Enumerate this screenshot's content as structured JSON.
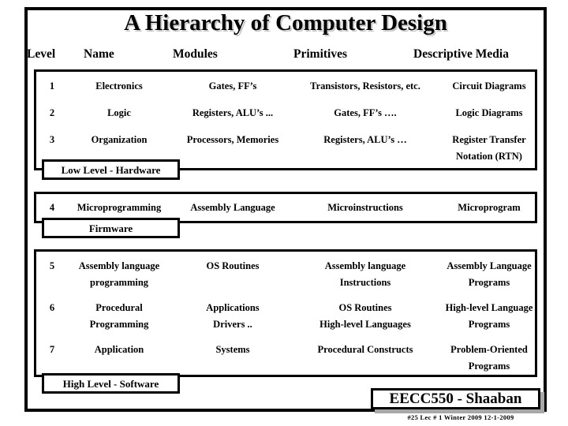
{
  "slide": {
    "title": "A Hierarchy of Computer Design",
    "columns": {
      "level": "Level",
      "name": "Name",
      "modules": "Modules",
      "primitives": "Primitives",
      "descriptive_media": "Descriptive  Media"
    },
    "groups": [
      {
        "id": "hardware",
        "tab_label": "Low Level - Hardware",
        "rows": [
          {
            "level": "1",
            "name": "Electronics",
            "modules": "Gates, FF’s",
            "primitives": "Transistors, Resistors, etc.",
            "descriptive_media": "Circuit Diagrams"
          },
          {
            "level": "2",
            "name": "Logic",
            "modules": "Registers, ALU’s ...",
            "primitives": "Gates, FF’s ….",
            "descriptive_media": "Logic Diagrams"
          },
          {
            "level": "3",
            "name": "Organization",
            "modules": "Processors, Memories",
            "primitives": "Registers, ALU’s …",
            "descriptive_media": "Register Transfer\nNotation (RTN)"
          }
        ]
      },
      {
        "id": "firmware",
        "tab_label": "Firmware",
        "rows": [
          {
            "level": "4",
            "name": "Microprogramming",
            "modules": "Assembly Language",
            "primitives": "Microinstructions",
            "descriptive_media": "Microprogram"
          }
        ]
      },
      {
        "id": "software",
        "tab_label": "High Level - Software",
        "rows": [
          {
            "level": "5",
            "name": "Assembly language\nprogramming",
            "modules": "OS Routines",
            "primitives": "Assembly language\nInstructions",
            "descriptive_media": "Assembly Language\nPrograms"
          },
          {
            "level": "6",
            "name": "Procedural\nProgramming",
            "modules": "Applications\nDrivers ..",
            "primitives": "OS Routines\nHigh-level Languages",
            "descriptive_media": "High-level Language\nPrograms"
          },
          {
            "level": "7",
            "name": "Application",
            "modules": "Systems",
            "primitives": "Procedural Constructs",
            "descriptive_media": "Problem-Oriented\nPrograms"
          }
        ]
      }
    ],
    "footer": {
      "badge": "EECC550 - Shaaban",
      "subtitle": "#25   Lec # 1   Winter 2009   12-1-2009"
    }
  }
}
